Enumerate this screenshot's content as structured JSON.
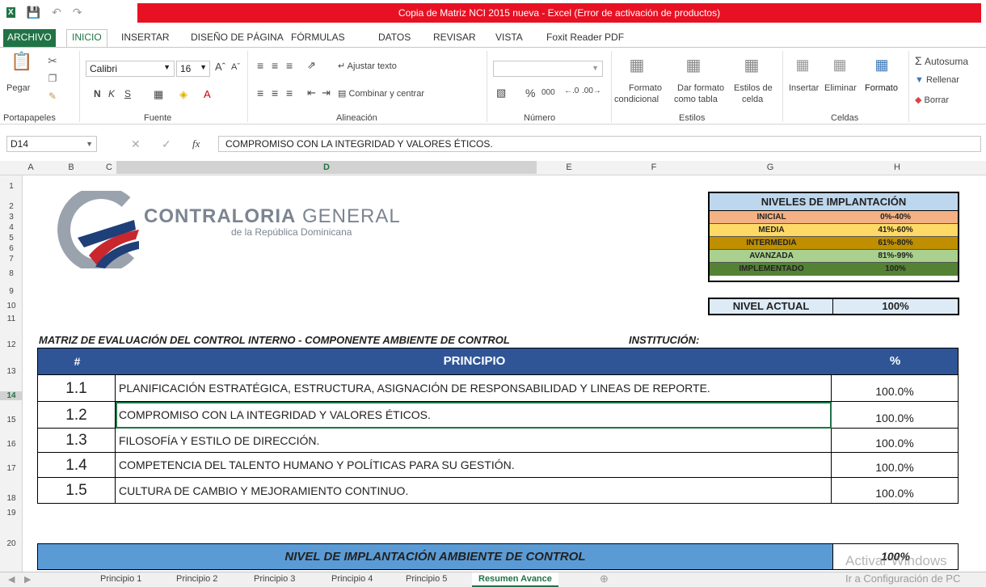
{
  "window": {
    "title": "Copia de Matriz NCI 2015 nueva -  Excel (Error de activación de productos)"
  },
  "ribbon_tabs": [
    "ARCHIVO",
    "INICIO",
    "INSERTAR",
    "DISEÑO DE PÁGINA",
    "FÓRMULAS",
    "DATOS",
    "REVISAR",
    "VISTA",
    "Foxit Reader PDF"
  ],
  "ribbon": {
    "paste": "Pegar",
    "font_name": "Calibri",
    "font_size": "16",
    "bold": "N",
    "italic": "K",
    "underline": "S",
    "wrap_text": "Ajustar texto",
    "merge_center": "Combinar y centrar",
    "percent": "%",
    "thousands": "000",
    "cond_format_1": "Formato",
    "cond_format_2": "condicional",
    "format_table_1": "Dar formato",
    "format_table_2": "como tabla",
    "cell_styles_1": "Estilos de",
    "cell_styles_2": "celda",
    "insert": "Insertar",
    "delete": "Eliminar",
    "format": "Formato",
    "autosum": "Autosuma",
    "fill": "Rellenar",
    "clear": "Borrar",
    "groups": {
      "clipboard": "Portapapeles",
      "font": "Fuente",
      "alignment": "Alineación",
      "number": "Número",
      "styles": "Estilos",
      "cells": "Celdas"
    }
  },
  "formula_bar": {
    "name_box": "D14",
    "fx": "fx",
    "content": "COMPROMISO CON LA INTEGRIDAD Y VALORES ÉTICOS."
  },
  "columns": [
    "A",
    "B",
    "C",
    "D",
    "E",
    "F",
    "G",
    "H"
  ],
  "rows": [
    "1",
    "2",
    "3",
    "4",
    "5",
    "6",
    "7",
    "8",
    "9",
    "10",
    "11",
    "12",
    "13",
    "14",
    "15",
    "16",
    "17",
    "18",
    "19",
    "20"
  ],
  "logo": {
    "main": "CONTRALORIA",
    "main2": "GENERAL",
    "sub": "de la República Dominicana"
  },
  "niveles": {
    "header": "NIVELES DE IMPLANTACIÓN",
    "items": [
      {
        "name": "INICIAL",
        "range": "0%-40%",
        "color": "#f4b183"
      },
      {
        "name": "MEDIA",
        "range": "41%-60%",
        "color": "#ffd966"
      },
      {
        "name": "INTERMEDIA",
        "range": "61%-80%",
        "color": "#bf8f00"
      },
      {
        "name": "AVANZADA",
        "range": "81%-99%",
        "color": "#a9d08e"
      },
      {
        "name": "IMPLEMENTADO",
        "range": "100%",
        "color": "#548235"
      }
    ]
  },
  "nivel_actual": {
    "label": "NIVEL ACTUAL",
    "value": "100%"
  },
  "matrix_title": "MATRIZ DE EVALUACIÓN DEL CONTROL INTERNO - COMPONENTE AMBIENTE DE CONTROL",
  "institucion_label": "INSTITUCIÓN:",
  "table": {
    "headers": [
      "#",
      "PRINCIPIO",
      "%"
    ],
    "rows": [
      {
        "num": "1.1",
        "text": "PLANIFICACIÓN ESTRATÉGICA, ESTRUCTURA, ASIGNACIÓN DE RESPONSABILIDAD Y LINEAS DE REPORTE.",
        "pct": "100.0%"
      },
      {
        "num": "1.2",
        "text": "COMPROMISO CON LA INTEGRIDAD Y VALORES ÉTICOS.",
        "pct": "100.0%"
      },
      {
        "num": "1.3",
        "text": "FILOSOFÍA Y ESTILO DE DIRECCIÓN.",
        "pct": "100.0%"
      },
      {
        "num": "1.4",
        "text": "COMPETENCIA DEL TALENTO HUMANO Y POLÍTICAS PARA SU GESTIÓN.",
        "pct": "100.0%"
      },
      {
        "num": "1.5",
        "text": "CULTURA DE CAMBIO Y MEJORAMIENTO CONTINUO.",
        "pct": "100.0%"
      }
    ]
  },
  "summary": {
    "label": "NIVEL DE IMPLANTACIÓN AMBIENTE DE CONTROL",
    "value": "100%"
  },
  "sheet_tabs": [
    "Principio 1",
    "Principio 2",
    "Principio 3",
    "Principio 4",
    "Principio 5",
    "Resumen Avance"
  ],
  "watermark": {
    "line1": "Activar Windows",
    "line2": "Ir a Configuración de PC"
  }
}
